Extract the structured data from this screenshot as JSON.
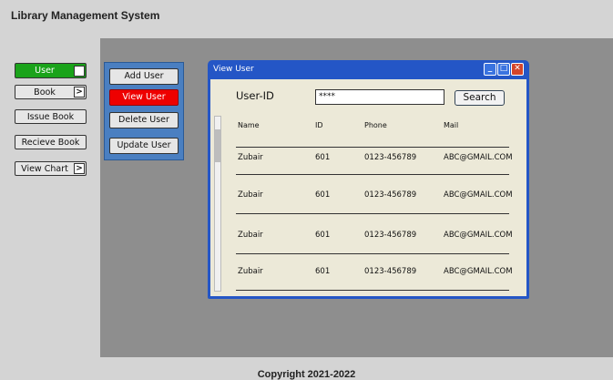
{
  "app": {
    "title": "Library Management System"
  },
  "nav": [
    {
      "label": "User",
      "arrow": ">",
      "active": true
    },
    {
      "label": "Book",
      "arrow": ">"
    },
    {
      "label": "Issue Book"
    },
    {
      "label": "Recieve Book"
    },
    {
      "label": "View Chart",
      "arrow": ">"
    }
  ],
  "submenu": [
    {
      "label": "Add User"
    },
    {
      "label": "View User",
      "active": true
    },
    {
      "label": "Delete User"
    },
    {
      "label": "Update User"
    }
  ],
  "dialog": {
    "title": "View User",
    "controls": {
      "minimize": "_",
      "maximize": "□",
      "close": "✕"
    },
    "userid_label": "User-ID",
    "userid_value": "****",
    "search_label": "Search",
    "columns": [
      "Name",
      "ID",
      "Phone",
      "Mail"
    ],
    "rows": [
      [
        "Zubair",
        "601",
        "0123-456789",
        "ABC@GMAIL.COM"
      ],
      [
        "Zubair",
        "601",
        "0123-456789",
        "ABC@GMAIL.COM"
      ],
      [
        "Zubair",
        "601",
        "0123-456789",
        "ABC@GMAIL.COM"
      ],
      [
        "Zubair",
        "601",
        "0123-456789",
        "ABC@GMAIL.COM"
      ]
    ]
  },
  "footer": {
    "text": "Copyright 2021-2022"
  },
  "colors": {
    "active_green": "#1aa31a",
    "active_red": "#ee0000",
    "submenu_blue": "#4a7fc1",
    "titlebar_blue": "#2456c6"
  }
}
